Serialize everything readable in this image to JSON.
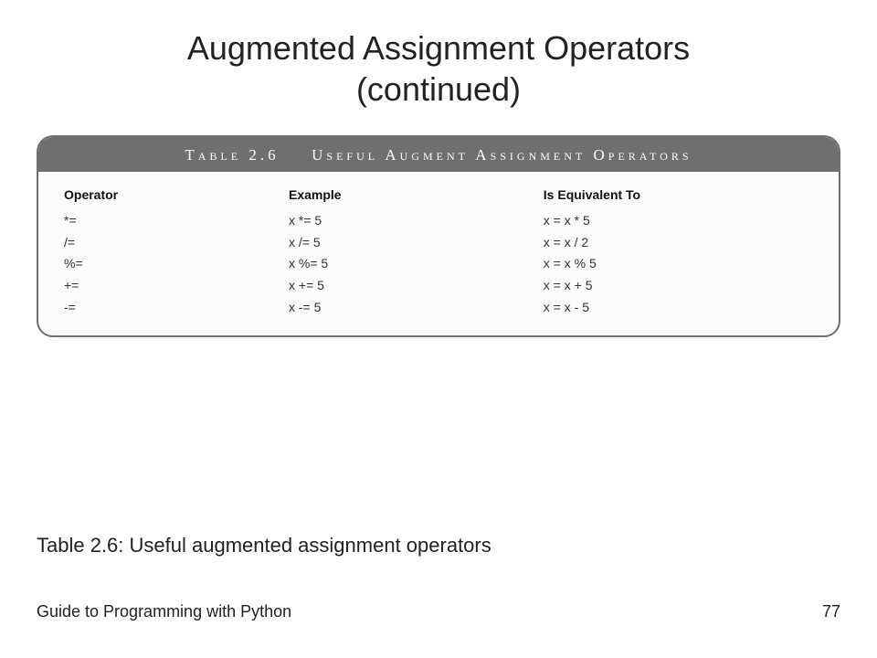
{
  "title_line1": "Augmented Assignment Operators",
  "title_line2": "(continued)",
  "table": {
    "label_prefix": "Table 2.6",
    "label_title": "Useful Augment Assignment Operators",
    "columns": {
      "c1": "Operator",
      "c2": "Example",
      "c3": "Is Equivalent To"
    },
    "rows": [
      {
        "op": "*=",
        "ex": "x *= 5",
        "eq": "x = x * 5"
      },
      {
        "op": "/=",
        "ex": "x /= 5",
        "eq": "x = x / 2"
      },
      {
        "op": "%=",
        "ex": "x %= 5",
        "eq": "x = x % 5"
      },
      {
        "op": "+=",
        "ex": "x += 5",
        "eq": "x = x + 5"
      },
      {
        "op": "-=",
        "ex": "x -= 5",
        "eq": "x = x - 5"
      }
    ]
  },
  "caption": "Table 2.6: Useful augmented assignment operators",
  "footer": {
    "left": "Guide to Programming with Python",
    "page": "77"
  }
}
